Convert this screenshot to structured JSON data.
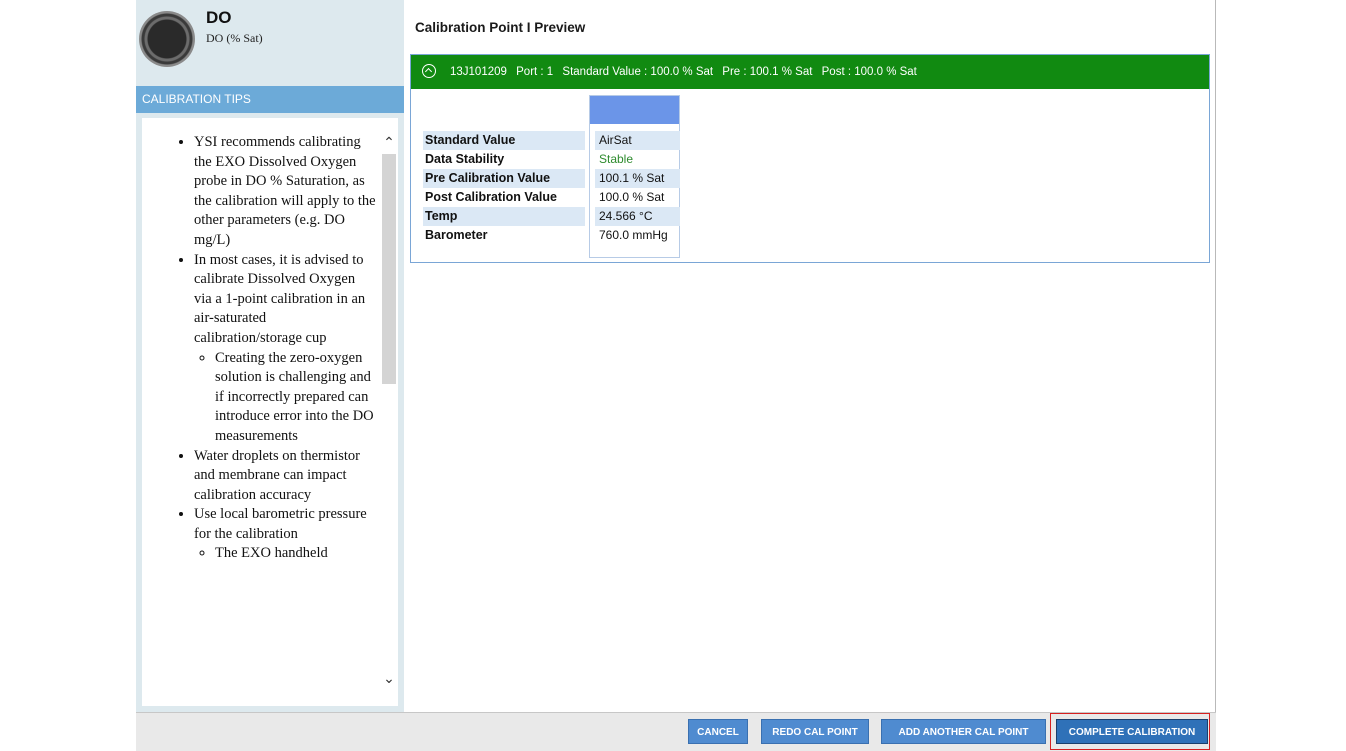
{
  "probe": {
    "title": "DO",
    "subtitle": "DO (% Sat)",
    "icon": "probe-sensor-icon"
  },
  "tips": {
    "header": "CALIBRATION TIPS",
    "items": [
      "YSI recommends calibrating the EXO Dissolved Oxygen probe in DO % Saturation, as the calibration will apply to the other parameters (e.g. DO mg/L)",
      "In most cases, it is advised to calibrate Dissolved Oxygen via a 1-point calibration in an air-saturated calibration/storage cup",
      "Water droplets on thermistor and membrane can impact calibration accuracy",
      "Use local barometric pressure for the calibration"
    ],
    "subitems": [
      "Creating the zero-oxygen solution is challenging and if incorrectly prepared can introduce error into the DO measurements",
      "The EXO handheld"
    ]
  },
  "main": {
    "title": "Calibration Point  I  Preview"
  },
  "cal_point": {
    "serial": "13J101209",
    "port": "Port : 1",
    "standard": "Standard Value : 100.0 % Sat",
    "pre": "Pre : 100.1 % Sat",
    "post": "Post : 100.0 % Sat"
  },
  "params": [
    {
      "label": "Standard Value",
      "value": "AirSat"
    },
    {
      "label": "Data Stability",
      "value": "Stable"
    },
    {
      "label": "Pre Calibration Value",
      "value": "100.1 % Sat"
    },
    {
      "label": "Post Calibration Value",
      "value": "100.0 % Sat"
    },
    {
      "label": "Temp",
      "value": "24.566 °C"
    },
    {
      "label": "Barometer",
      "value": "760.0 mmHg"
    }
  ],
  "footer": {
    "cancel": "CANCEL",
    "redo": "REDO CAL POINT",
    "add": "ADD ANOTHER CAL POINT",
    "complete": "COMPLETE CALIBRATION"
  },
  "colors": {
    "header_green": "#118a11",
    "tips_blue": "#6caad8",
    "button_blue": "#4f8bd0",
    "highlight_red": "#d62020"
  }
}
